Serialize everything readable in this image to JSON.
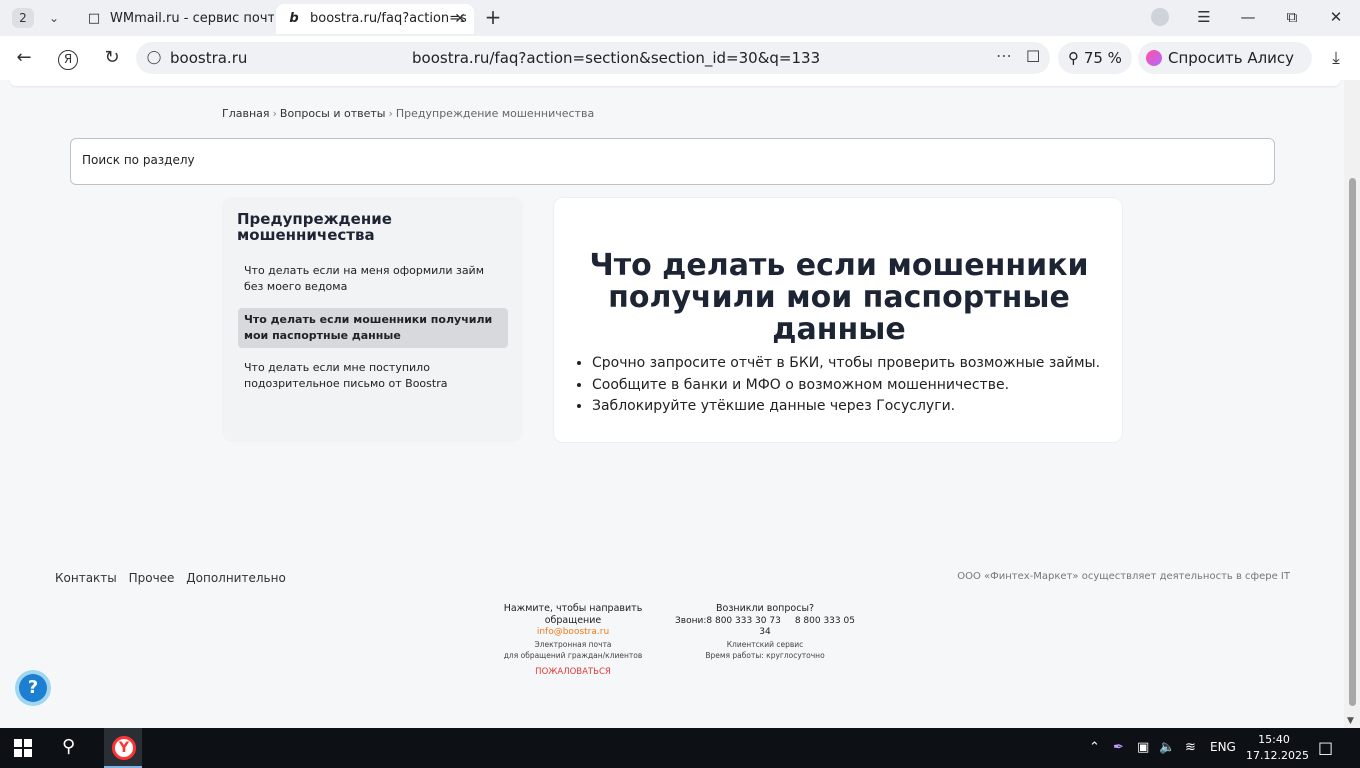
{
  "browser": {
    "tab_count": "2",
    "tabs": [
      {
        "title": "WMmail.ru - сервис почто"
      },
      {
        "title": "boostra.ru/faq?action=s"
      }
    ],
    "address": {
      "domain": "boostra.ru",
      "url": "boostra.ru/faq?action=section&section_id=30&q=133"
    },
    "zoom": "75 %",
    "alice_label": "Спросить Алису AI"
  },
  "page": {
    "breadcrumb": {
      "home": "Главная",
      "section": "Вопросы и ответы",
      "current": "Предупреждение мошенничества"
    },
    "search_placeholder": "Поиск по разделу",
    "sidebar": {
      "title": "Предупреждение мошенничества",
      "items": [
        {
          "label": "Что делать если на меня оформили займ без моего ведома",
          "active": false
        },
        {
          "label": "Что делать если мошенники получили мои паспортные данные",
          "active": true
        },
        {
          "label": "Что делать если мне поступило подозрительное письмо от Boostra",
          "active": false
        }
      ]
    },
    "article": {
      "title": "Что делать если мошенники получили мои паспортные данные",
      "bullets": [
        "Срочно запросите отчёт в БКИ, чтобы проверить возможные займы.",
        "Сообщите в банки и МФО о возможном мошенничестве.",
        "Заблокируйте утёкшие данные через Госуслуги."
      ]
    },
    "footer": {
      "links": [
        "Контакты",
        "Прочее",
        "Дополнительно"
      ],
      "legal": "ООО «Финтех-Маркет» осуществляет деятельность в сфере IT",
      "appeal": {
        "heading": "Нажмите, чтобы направить обращение",
        "email": "info@boostra.ru",
        "caption1": "Электронная почта",
        "caption2": "для обращений граждан/клиентов",
        "complain": "ПОЖАЛОВАТЬСЯ"
      },
      "questions": {
        "heading": "Возникли вопросы?",
        "phone_prefix": "Звони:",
        "phone1": "8 800 333 30 73",
        "phone2": "8 800 333 05 34",
        "caption1": "Клиентский сервис",
        "caption2": "Время работы: круглосуточно"
      },
      "help_icon": "?"
    }
  },
  "taskbar": {
    "language": "ENG",
    "time": "15:40",
    "date": "17.12.2025"
  },
  "colors": {
    "accent_orange": "#f07a1a",
    "complain_red": "#e03a3a",
    "help_blue": "#1d7fd1"
  }
}
